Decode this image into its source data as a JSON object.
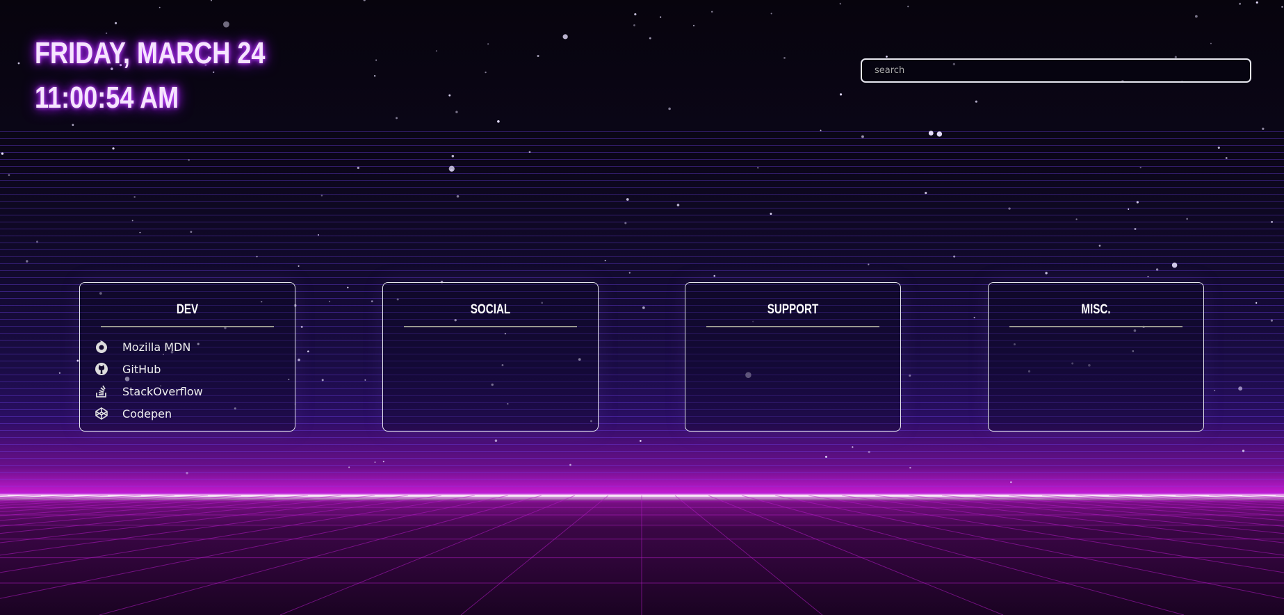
{
  "clock": {
    "date": "FRIDAY, MARCH 24",
    "time": "11:00:54 AM"
  },
  "search": {
    "placeholder": "search",
    "value": ""
  },
  "colors": {
    "glow": "#c34cff",
    "horizon": "#c41ad0",
    "card_border": "#e6e6ee"
  },
  "categories": [
    {
      "title": "DEV",
      "links": [
        {
          "label": "Mozilla MDN",
          "icon": "firefox-icon"
        },
        {
          "label": "GitHub",
          "icon": "github-icon"
        },
        {
          "label": "StackOverflow",
          "icon": "stackoverflow-icon"
        },
        {
          "label": "Codepen",
          "icon": "codepen-icon"
        }
      ]
    },
    {
      "title": "SOCIAL",
      "links": []
    },
    {
      "title": "SUPPORT",
      "links": []
    },
    {
      "title": "MISC.",
      "links": []
    }
  ]
}
